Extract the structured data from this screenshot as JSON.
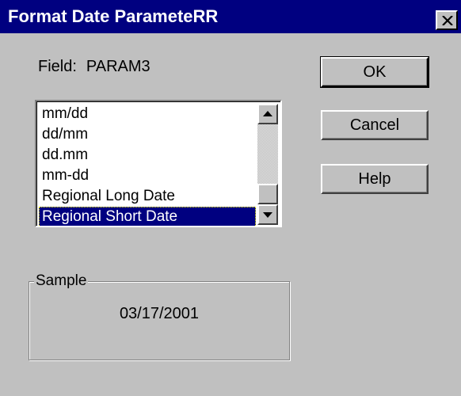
{
  "dialog": {
    "title": "Format Date ParameteRR"
  },
  "field": {
    "label": "Field:",
    "value": "PARAM3"
  },
  "format_list": {
    "items": [
      "mm/dd",
      "dd/mm",
      "dd.mm",
      "mm-dd",
      "Regional Long Date",
      "Regional Short Date"
    ],
    "selected": "Regional Short Date"
  },
  "buttons": {
    "ok": "OK",
    "cancel": "Cancel",
    "help": "Help"
  },
  "sample": {
    "label": "Sample",
    "value": "03/17/2001"
  },
  "icons": {
    "close": "close-icon",
    "scroll_up": "arrow-up-icon",
    "scroll_down": "arrow-down-icon"
  },
  "colors": {
    "titlebar": "#000080",
    "face": "#c0c0c0",
    "selection": "#000080"
  }
}
